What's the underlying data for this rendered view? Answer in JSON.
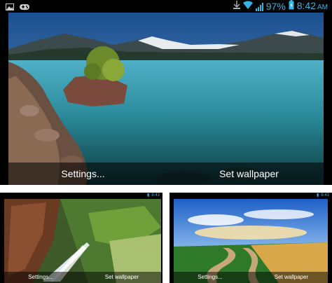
{
  "main": {
    "status_bar": {
      "battery_percent": "97%",
      "time": "8:42",
      "am_pm": "AM"
    },
    "buttons": {
      "settings": "Settings...",
      "set_wallpaper": "Set wallpaper"
    }
  },
  "left_preview": {
    "status_bar": {
      "time": "8:43"
    },
    "buttons": {
      "settings": "Settings...",
      "set_wallpaper": "Set wallpaper"
    }
  },
  "right_preview": {
    "status_bar": {
      "time": "8:43"
    },
    "buttons": {
      "settings": "Settings...",
      "set_wallpaper": "Set wallpaper"
    }
  },
  "colors": {
    "status_accent": "#33b5e5",
    "statusbar_bg": "#000000",
    "actionbar_overlay": "rgba(0,0,0,0.55)"
  },
  "icons": [
    "image-icon",
    "gamepad-icon",
    "download-icon",
    "wifi-icon",
    "signal-icon",
    "battery-icon"
  ]
}
